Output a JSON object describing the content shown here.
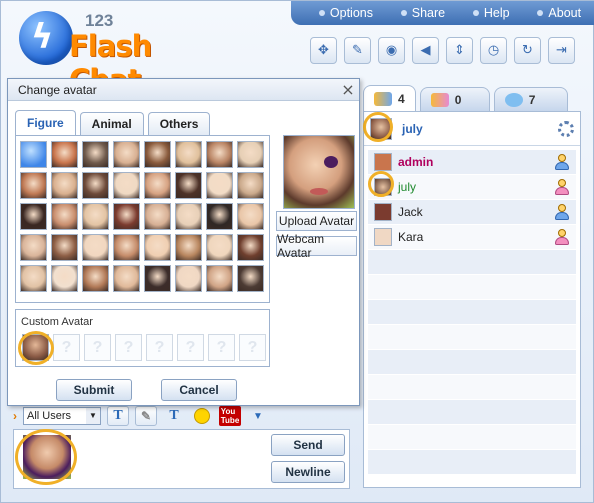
{
  "app": {
    "logo_number": "123",
    "logo_name": "Flash Chat"
  },
  "topnav": [
    {
      "label": "Options"
    },
    {
      "label": "Share"
    },
    {
      "label": "Help"
    },
    {
      "label": "About"
    }
  ],
  "toolbar": [
    {
      "icon": "gamepad-icon"
    },
    {
      "icon": "edit-icon"
    },
    {
      "icon": "webcam-icon"
    },
    {
      "icon": "speaker-icon"
    },
    {
      "icon": "sort-icon"
    },
    {
      "icon": "clock-icon"
    },
    {
      "icon": "refresh-icon"
    },
    {
      "icon": "logout-icon"
    }
  ],
  "right_tabs": [
    {
      "icon": "users-icon",
      "count": "4"
    },
    {
      "icon": "rooms-icon",
      "count": "0"
    },
    {
      "icon": "chat-icon",
      "count": "7"
    }
  ],
  "current_user": {
    "name": "july"
  },
  "users": [
    {
      "name": "admin",
      "role": "admin",
      "gender": "male"
    },
    {
      "name": "july",
      "role": "self",
      "gender": "female"
    },
    {
      "name": "Jack",
      "role": "user",
      "gender": "male"
    },
    {
      "name": "Kara",
      "role": "user",
      "gender": "female"
    }
  ],
  "dialog": {
    "title": "Change avatar",
    "close": "×",
    "tabs": [
      {
        "label": "Figure"
      },
      {
        "label": "Animal"
      },
      {
        "label": "Others"
      }
    ],
    "upload_label": "Upload Avatar",
    "webcam_label": "Webcam Avatar",
    "custom_label": "Custom Avatar",
    "submit_label": "Submit",
    "cancel_label": "Cancel",
    "empty_slot": "?"
  },
  "avatar_colors": [
    "#3f86e8",
    "#c9754d",
    "#6f5a4c",
    "#d8b092",
    "#8a5b3d",
    "#e0c09c",
    "#b98464",
    "#e6cfb5",
    "#c07a55",
    "#d9b08f",
    "#6d4a3a",
    "#efd9c3",
    "#d6a282",
    "#4d3228",
    "#f2dcc6",
    "#caa98b",
    "#3a2722",
    "#c98e6e",
    "#e3c4a4",
    "#7b3b2f",
    "#d7b095",
    "#e8d0b8",
    "#2f2725",
    "#e9c6a8",
    "#d9b49a",
    "#8e5f46",
    "#f1d7c0",
    "#c58c6a",
    "#f0cfb2",
    "#b8865f",
    "#efd6bd",
    "#6f3f2e",
    "#e1c2a5",
    "#f2e0cf",
    "#b27a58",
    "#e0b99a",
    "#3c2d2a",
    "#f0d8c4",
    "#d0a486",
    "#4c3b34"
  ],
  "composer": {
    "recipient": "All Users",
    "send_label": "Send",
    "newline_label": "Newline",
    "youtube_label": "You Tube"
  }
}
